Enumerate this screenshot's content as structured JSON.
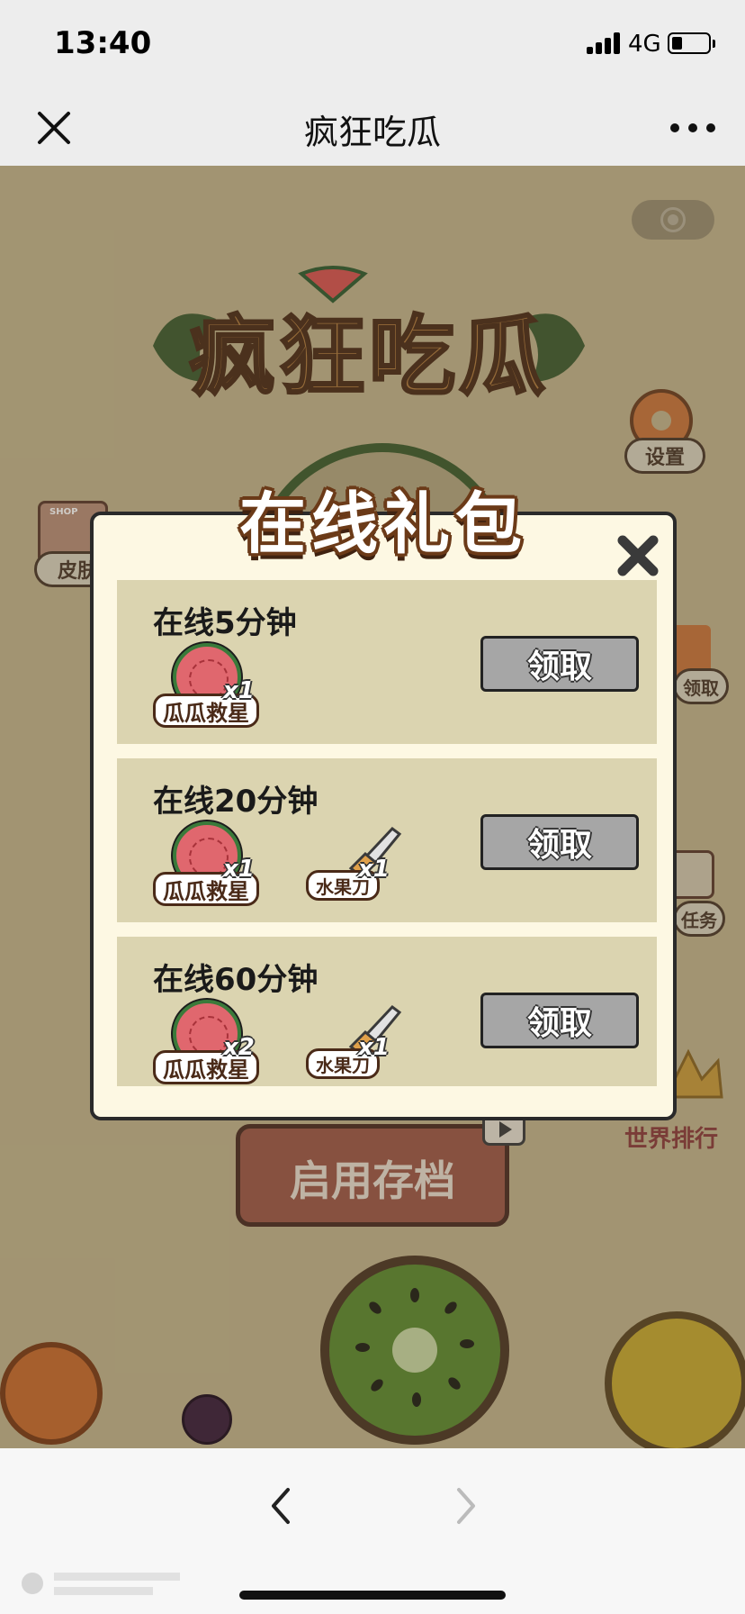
{
  "status_bar": {
    "time": "13:40",
    "network": "4G",
    "battery_level": 0.3
  },
  "nav": {
    "title": "疯狂吃瓜"
  },
  "game": {
    "logo_text": "疯狂吃瓜",
    "settings_label": "设置",
    "skin_label": "皮肤",
    "shop_sign": "SHOP",
    "claim_side_label": "领取",
    "task_label": "任务",
    "rank_label": "世界排行",
    "load_button_label": "启用存档"
  },
  "modal": {
    "title": "在线礼包",
    "rows": [
      {
        "label": "在线5分钟",
        "claim_label": "领取",
        "items": [
          {
            "name": "瓜瓜救星",
            "count": "x1"
          }
        ]
      },
      {
        "label": "在线20分钟",
        "claim_label": "领取",
        "items": [
          {
            "name": "瓜瓜救星",
            "count": "x1"
          },
          {
            "name": "水果刀",
            "count": "x1"
          }
        ]
      },
      {
        "label": "在线60分钟",
        "claim_label": "领取",
        "items": [
          {
            "name": "瓜瓜救星",
            "count": "x2"
          },
          {
            "name": "水果刀",
            "count": "x1"
          }
        ]
      }
    ]
  },
  "icons": {
    "close": "close-icon",
    "more": "more-icon",
    "back": "chevron-left-icon",
    "forward": "chevron-right-icon",
    "modal_close": "close-icon"
  },
  "colors": {
    "game_bg": "#c2b38b",
    "modal_bg": "#fdf8e3",
    "row_bg": "#dbd4b0",
    "button_gray": "#a6a6a6"
  }
}
